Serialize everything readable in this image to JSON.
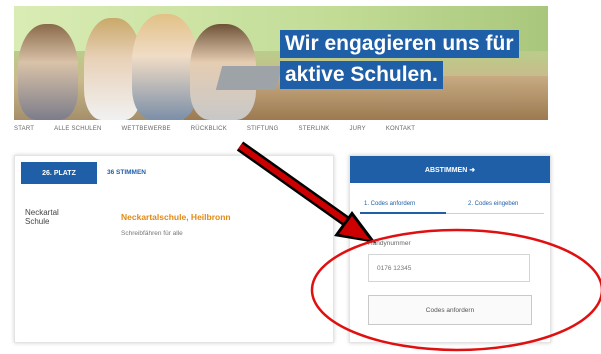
{
  "hero": {
    "headline_line1": "Wir engagieren uns für",
    "headline_line2": "aktive Schulen."
  },
  "nav": {
    "items": [
      "Start",
      "Alle Schulen",
      "Wettbewerbe",
      "Rückblick",
      "Stiftung",
      "Sterlink",
      "Jury",
      "Kontakt"
    ]
  },
  "school": {
    "rank_label": "26. PLATZ",
    "votes_label": "36 STIMMEN",
    "logo_line1": "Neckartal",
    "logo_line2": "Schule",
    "name": "Neckartalschule, Heilbronn",
    "description": "Schreibfähren für alle"
  },
  "vote": {
    "button_label": "ABSTIMMEN ➜",
    "step1_label": "1. Codes anfordern",
    "step2_label": "2. Codes eingeben",
    "phone_label": "Handynummer",
    "phone_placeholder": "0176 12345",
    "request_code_label": "Codes anfordern"
  },
  "annotation": {
    "arrow_color": "#cc0000",
    "ellipse_color": "#e01010"
  },
  "colors": {
    "brand_blue": "#1e5fa8",
    "school_name_orange": "#e08a14"
  }
}
